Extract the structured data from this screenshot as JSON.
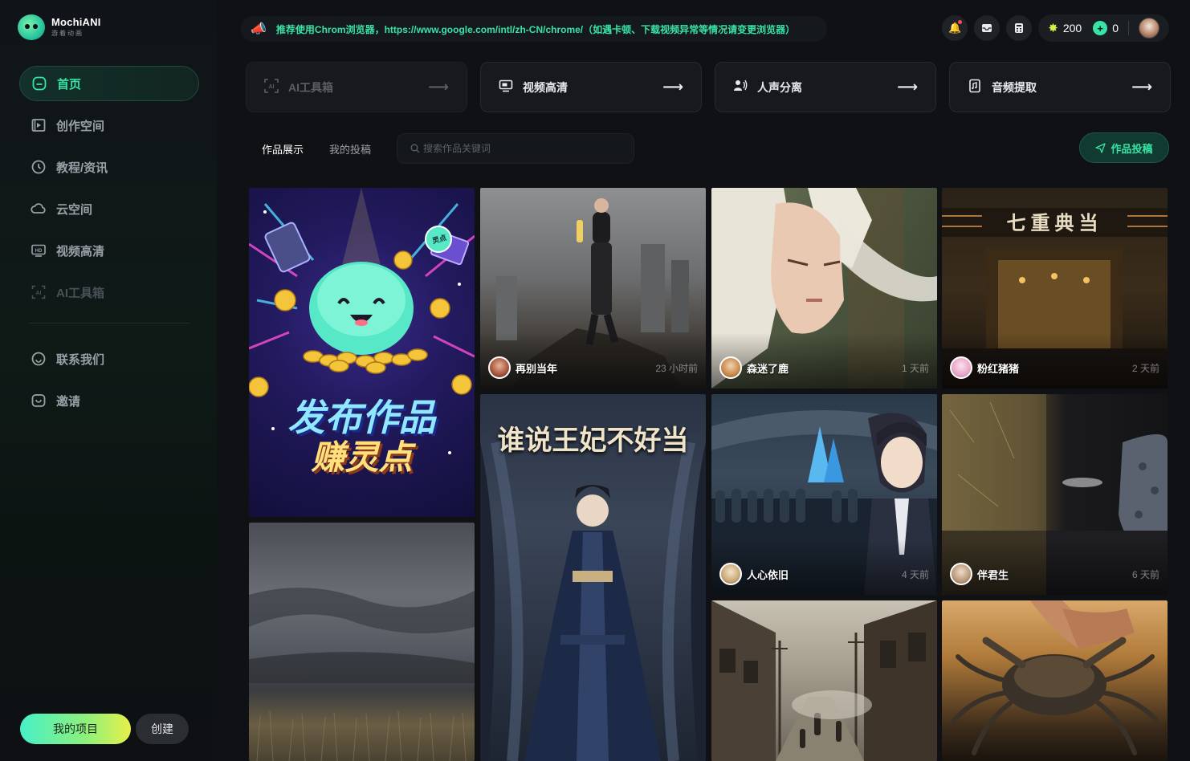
{
  "app": {
    "name": "MochiANI",
    "subtitle": "游着动画"
  },
  "sidebar": {
    "items": [
      {
        "label": "首页",
        "icon": "home-icon",
        "state": "active"
      },
      {
        "label": "创作空间",
        "icon": "film-icon",
        "state": "normal"
      },
      {
        "label": "教程/资讯",
        "icon": "clock-icon",
        "state": "normal"
      },
      {
        "label": "云空间",
        "icon": "cloud-icon",
        "state": "normal"
      },
      {
        "label": "视频高清",
        "icon": "hd-icon",
        "state": "normal"
      },
      {
        "label": "AI工具箱",
        "icon": "ai-icon",
        "state": "disabled"
      }
    ],
    "secondary": [
      {
        "label": "联系我们",
        "icon": "chat-icon"
      },
      {
        "label": "邀请",
        "icon": "invite-icon"
      }
    ],
    "my_projects_label": "我的项目",
    "create_label": "创建"
  },
  "notice": {
    "text": "推荐使用Chrom浏览器，https://www.google.com/intl/zh-CN/chrome/（如遇卡顿、下载视频异常等情况请变更浏览器）",
    "icon": "megaphone-icon"
  },
  "topbar": {
    "credits": "200",
    "coins": "0"
  },
  "tools": [
    {
      "label": "AI工具箱",
      "icon": "ai-scan-icon",
      "state": "disabled"
    },
    {
      "label": "视频高清",
      "icon": "monitor-icon",
      "state": "normal"
    },
    {
      "label": "人声分离",
      "icon": "voice-icon",
      "state": "normal"
    },
    {
      "label": "音频提取",
      "icon": "audio-file-icon",
      "state": "normal"
    }
  ],
  "tabs": {
    "showcase": "作品展示",
    "my_submissions": "我的投稿"
  },
  "search": {
    "placeholder": "搜索作品关键词"
  },
  "submit_label": "作品投稿",
  "promo": {
    "line1": "发布作品",
    "line2": "赚灵点",
    "badge": "灵点"
  },
  "cards": [
    {
      "author": "再别当年",
      "time": "23 小时前",
      "title": ""
    },
    {
      "author": "森迷了鹿",
      "time": "1 天前",
      "title": ""
    },
    {
      "author": "粉红猪猪",
      "time": "2 天前",
      "title": "七重典当"
    },
    {
      "author": "",
      "time": "",
      "title": "谁说王妃不好当"
    },
    {
      "author": "人心依旧",
      "time": "4 天前",
      "title": ""
    },
    {
      "author": "伴君生",
      "time": "6 天前",
      "title": ""
    }
  ],
  "colors": {
    "accent": "#38e3a6",
    "background": "#0f1115",
    "card": "#17191d"
  }
}
